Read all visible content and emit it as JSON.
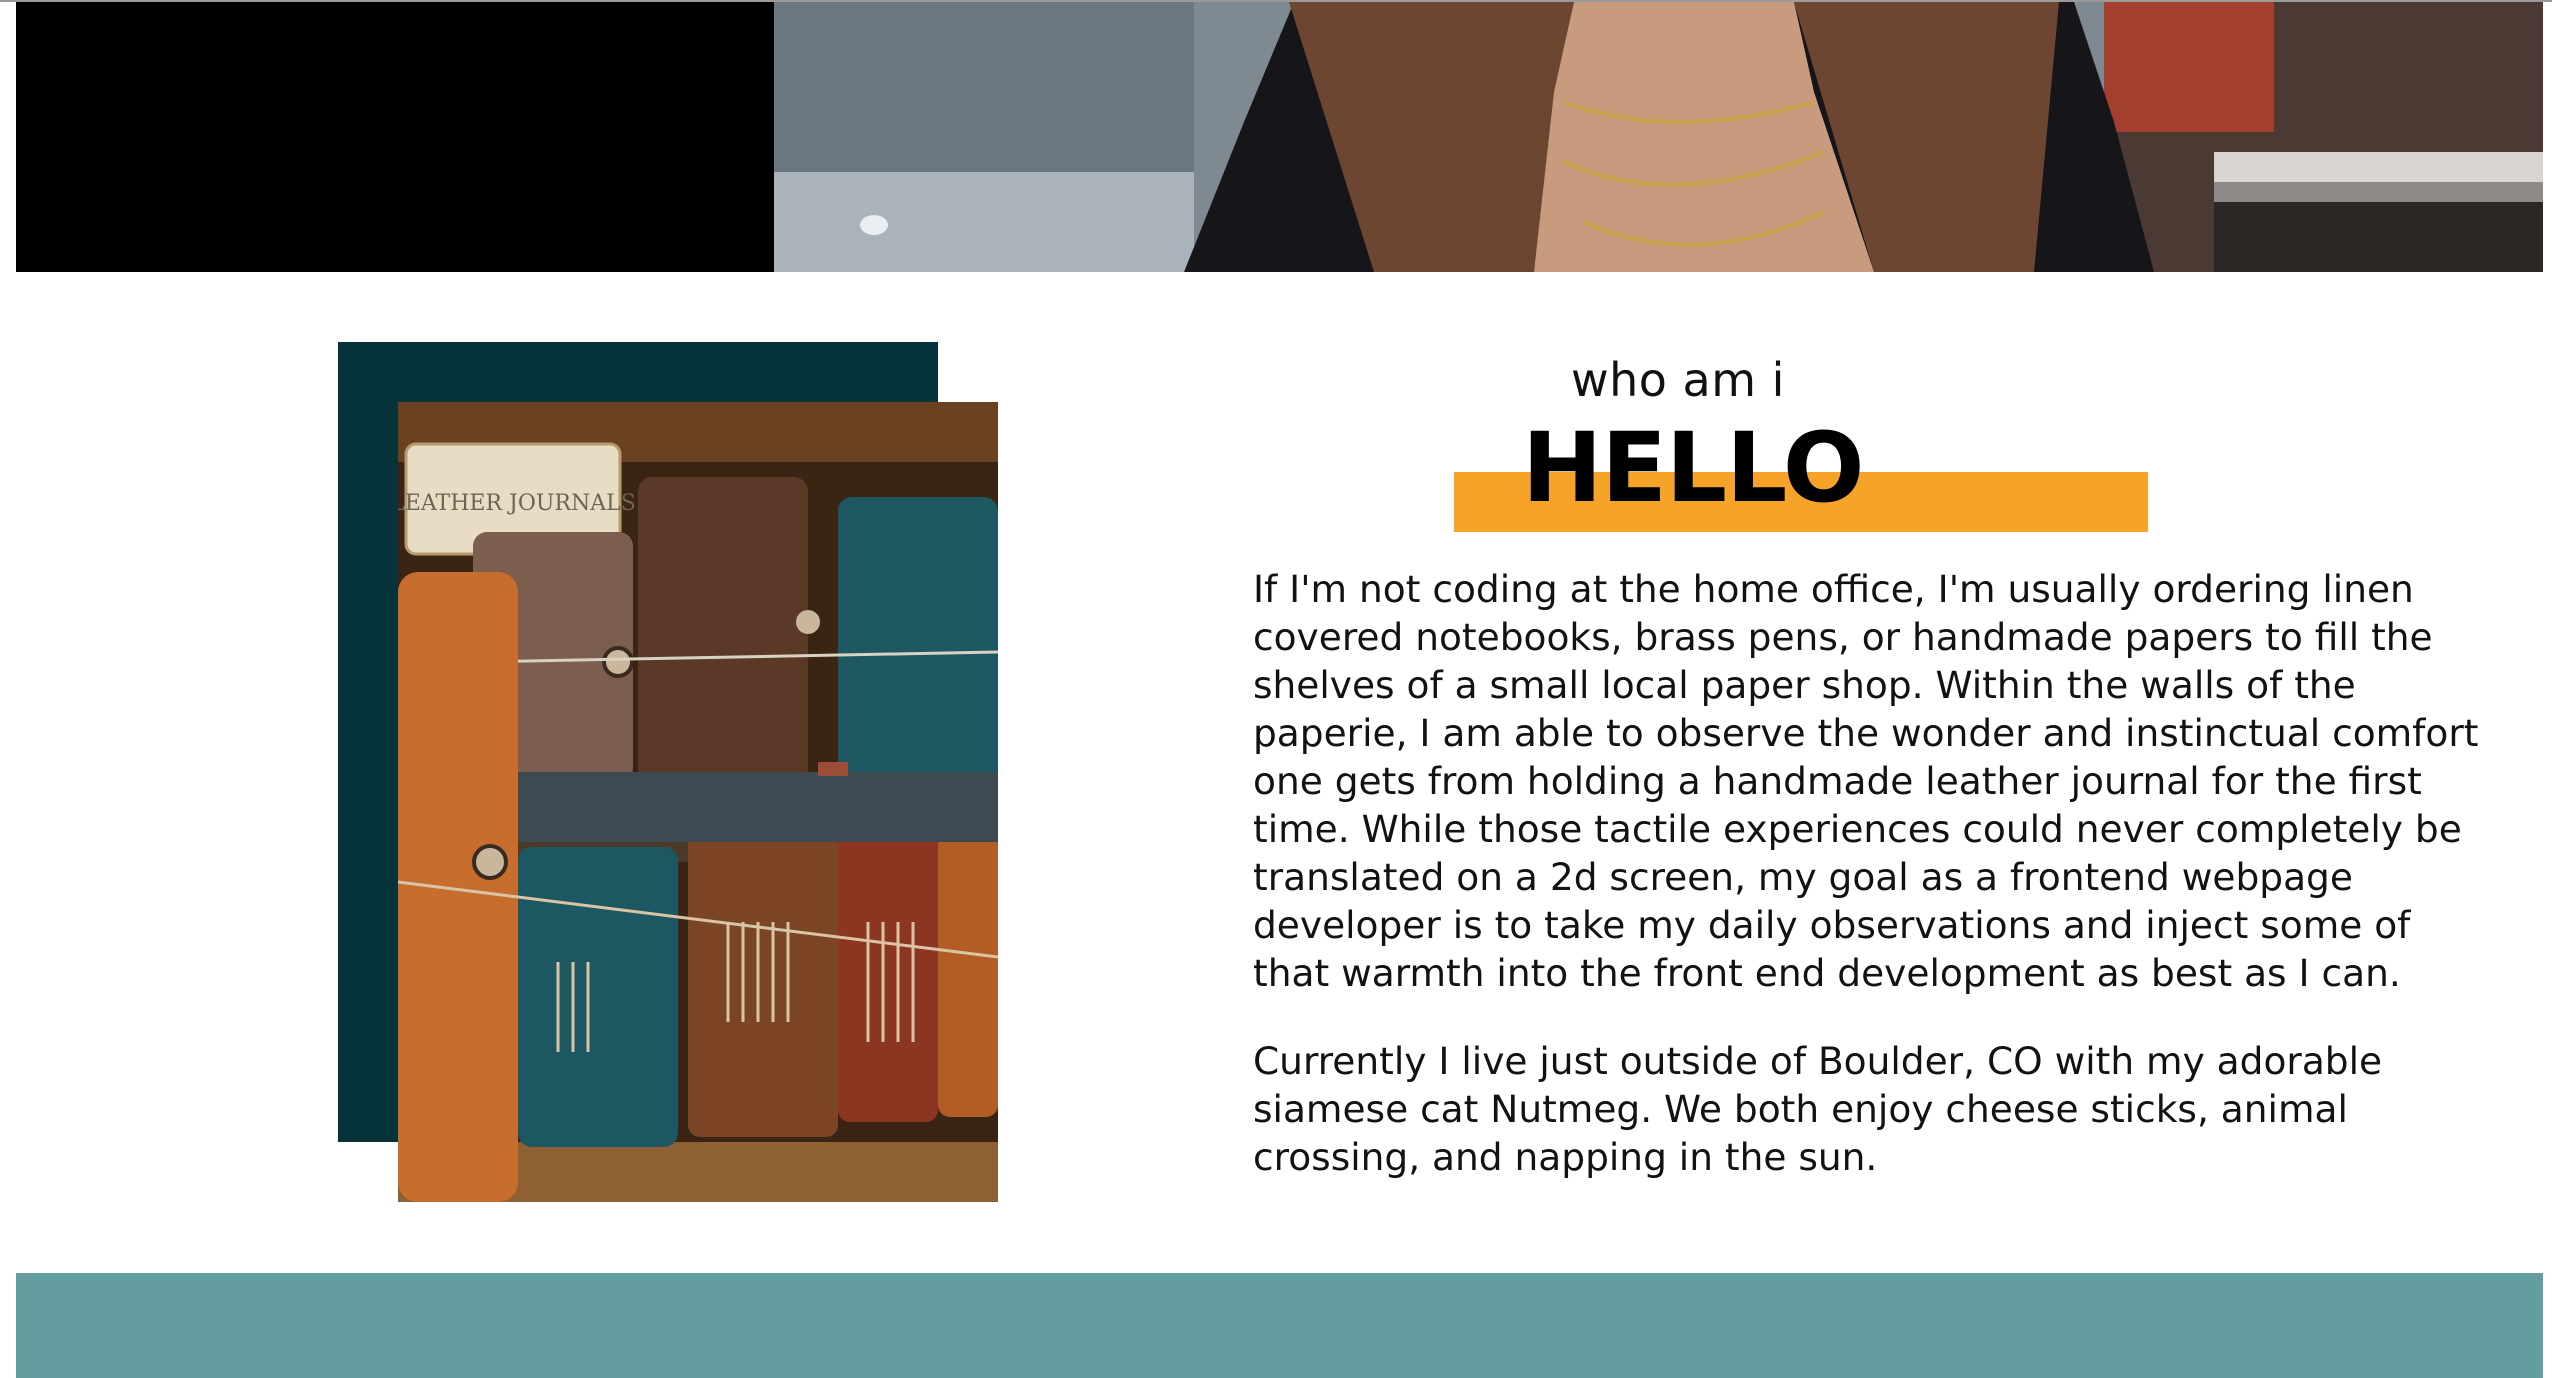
{
  "hero": {
    "photo_alt": "",
    "colors": {
      "left_panel": "#000000"
    }
  },
  "about": {
    "eyebrow": "who am i",
    "heading": "HELLO",
    "paragraphs": [
      "If I'm not coding at the home office, I'm usually ordering linen covered notebooks, brass pens, or handmade papers to fill the shelves of a small local paper shop. Within the walls of the paperie, I am able to observe the wonder and instinctual comfort one gets from holding a handmade leather journal for the first time. While those tactile experiences could never completely be translated on a 2d screen, my goal as a frontend webpage developer is to take my daily observations and inject some of that warmth into the front end development as best as I can.",
      "Currently I live just outside of Boulder, CO with my adorable siamese cat Nutmeg. We both enjoy cheese sticks, animal crossing, and napping in the sun."
    ],
    "photo_label": "LEATHER JOURNALS",
    "colors": {
      "frame_block": "#07333a",
      "heading_highlight": "#f6a329",
      "footer_band": "#639da0"
    }
  }
}
